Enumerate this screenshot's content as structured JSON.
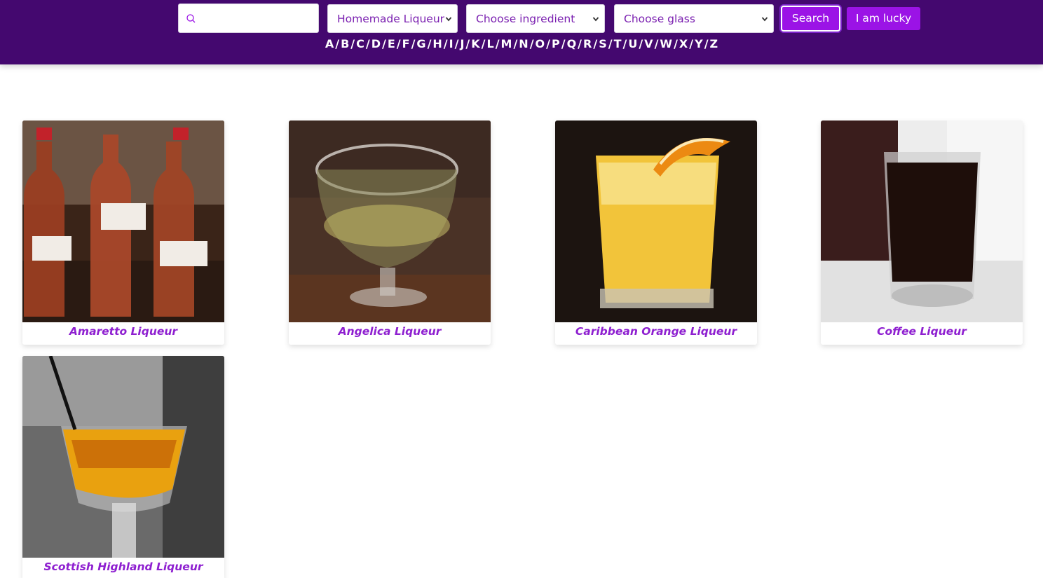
{
  "search": {
    "value": "",
    "placeholder": ""
  },
  "filters": {
    "category": {
      "selected": "Homemade Liqueur"
    },
    "ingredient": {
      "selected": "Choose ingredient"
    },
    "glass": {
      "selected": "Choose glass"
    }
  },
  "buttons": {
    "search": "Search",
    "lucky": "I am lucky"
  },
  "alphabet": [
    "A",
    "B",
    "C",
    "D",
    "E",
    "F",
    "G",
    "H",
    "I",
    "J",
    "K",
    "L",
    "M",
    "N",
    "O",
    "P",
    "Q",
    "R",
    "S",
    "T",
    "U",
    "V",
    "W",
    "X",
    "Y",
    "Z"
  ],
  "alphabet_separator": "/",
  "colors": {
    "header_bg": "#44086f",
    "accent": "#9b13e6",
    "card_title": "#8e1fd0"
  },
  "icons": {
    "search": "magnifier-icon",
    "dropdown": "chevron-down-icon"
  },
  "drinks": [
    {
      "name": "Amaretto Liqueur",
      "image": "three-amaretto-bottles"
    },
    {
      "name": "Angelica Liqueur",
      "image": "glass-with-pale-liqueur"
    },
    {
      "name": "Caribbean Orange Liqueur",
      "image": "orange-drink-with-orange-slice"
    },
    {
      "name": "Coffee Liqueur",
      "image": "shot-glass-dark-coffee-liqueur"
    },
    {
      "name": "Scottish Highland Liqueur",
      "image": "stemmed-glass-amber-liqueur"
    }
  ]
}
